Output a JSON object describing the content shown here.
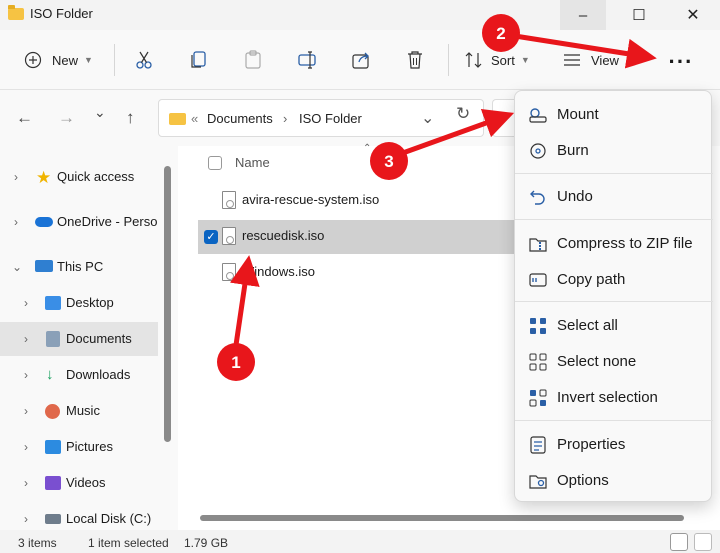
{
  "window": {
    "title": "ISO Folder",
    "min": "–",
    "max": "☐",
    "close": "✕"
  },
  "toolbar": {
    "new_label": "New",
    "sort_label": "Sort",
    "view_label": "View",
    "more": "···"
  },
  "nav": {
    "back": "←",
    "forward": "→",
    "recent": "⌄",
    "up": "↑",
    "address": {
      "prefix": "«",
      "crumb1": "Documents",
      "sep": "›",
      "crumb2": "ISO Folder",
      "dropdown": "⌄",
      "refresh": "↻"
    }
  },
  "sidebar": {
    "items": [
      {
        "label": "Quick access",
        "arrow": "›"
      },
      {
        "label": "OneDrive - Perso",
        "arrow": "›"
      },
      {
        "label": "This PC",
        "arrow": "⌄"
      },
      {
        "label": "Desktop",
        "arrow": "›"
      },
      {
        "label": "Documents",
        "arrow": "›"
      },
      {
        "label": "Downloads",
        "arrow": "›"
      },
      {
        "label": "Music",
        "arrow": "›"
      },
      {
        "label": "Pictures",
        "arrow": "›"
      },
      {
        "label": "Videos",
        "arrow": "›"
      },
      {
        "label": "Local Disk (C:)",
        "arrow": "›"
      }
    ]
  },
  "files": {
    "column_name": "Name",
    "rows": [
      {
        "name": "avira-rescue-system.iso"
      },
      {
        "name": "rescuedisk.iso",
        "selected": true
      },
      {
        "name": "Windows.iso"
      }
    ]
  },
  "status": {
    "items": "3 items",
    "selected": "1 item selected",
    "size": "1.79 GB"
  },
  "menu": {
    "mount": "Mount",
    "burn": "Burn",
    "undo": "Undo",
    "compress": "Compress to ZIP file",
    "copy_path": "Copy path",
    "select_all": "Select all",
    "select_none": "Select none",
    "invert": "Invert selection",
    "properties": "Properties",
    "options": "Options"
  },
  "annotations": {
    "badge1": "1",
    "badge2": "2",
    "badge3": "3",
    "color": "#e8161b"
  }
}
